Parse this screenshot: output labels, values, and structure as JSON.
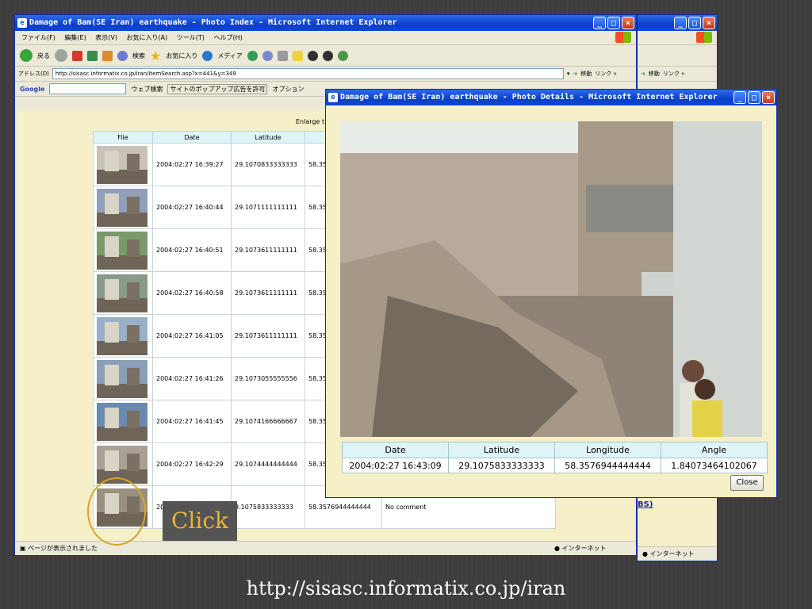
{
  "win_back": {
    "title": "",
    "links": "リンク »",
    "go": "移動",
    "status": "インターネット",
    "bs_link": "BS)"
  },
  "win_index": {
    "title": "Damage of Bam(SE Iran) earthquake - Photo Index - Microsoft Internet Explorer",
    "menu": [
      "ファイル(F)",
      "編集(E)",
      "表示(V)",
      "お気に入り(A)",
      "ツール(T)",
      "ヘルプ(H)"
    ],
    "toolbar": {
      "back": "戻る",
      "search": "検索",
      "favorites": "お気に入り",
      "media": "メディア"
    },
    "address_label": "アドレス(D)",
    "address": "http://sisasc.informatix.co.jp/iran/itemSearch.asp?x=441&y=349",
    "go": "移動",
    "links": "リンク »",
    "google": {
      "label": "Google",
      "search": "ウェブ検索",
      "popup": "サイトのポップアップ広告を許可",
      "options": "オプション"
    },
    "enlarge_text": "Enlarge t",
    "columns": [
      "File",
      "Date",
      "Latitude"
    ],
    "rows": [
      {
        "date": "2004:02:27 16:39:27",
        "lat": "29.1070833333333",
        "lon": "58.35"
      },
      {
        "date": "2004:02:27 16:40:44",
        "lat": "29.1071111111111",
        "lon": "58.35"
      },
      {
        "date": "2004:02:27 16:40:51",
        "lat": "29.1073611111111",
        "lon": "58.35"
      },
      {
        "date": "2004:02:27 16:40:58",
        "lat": "29.1073611111111",
        "lon": "58.35"
      },
      {
        "date": "2004:02:27 16:41:05",
        "lat": "29.1073611111111",
        "lon": "58.35"
      },
      {
        "date": "2004:02:27 16:41:26",
        "lat": "29.1073055555556",
        "lon": "58.35"
      },
      {
        "date": "2004:02:27 16:41:45",
        "lat": "29.1074166666667",
        "lon": "58.35"
      },
      {
        "date": "2004:02:27 16:42:29",
        "lat": "29.1074444444444",
        "lon": "58.35"
      },
      {
        "date": "200",
        "lat": "9.1075833333333",
        "lon": "58.3576944444444",
        "comment": "No comment"
      }
    ],
    "status": "ページが表示されました",
    "zone": "インターネット"
  },
  "win_details": {
    "title": "Damage of Bam(SE Iran) earthquake - Photo Details - Microsoft Internet Explorer",
    "columns": [
      "Date",
      "Latitude",
      "Longitude",
      "Angle"
    ],
    "values": [
      "2004:02:27 16:43:09",
      "29.1075833333333",
      "58.3576944444444",
      "1.84073464102067"
    ],
    "close": "Close"
  },
  "callout": "Click",
  "url": "http://sisasc.informatix.co.jp/iran"
}
